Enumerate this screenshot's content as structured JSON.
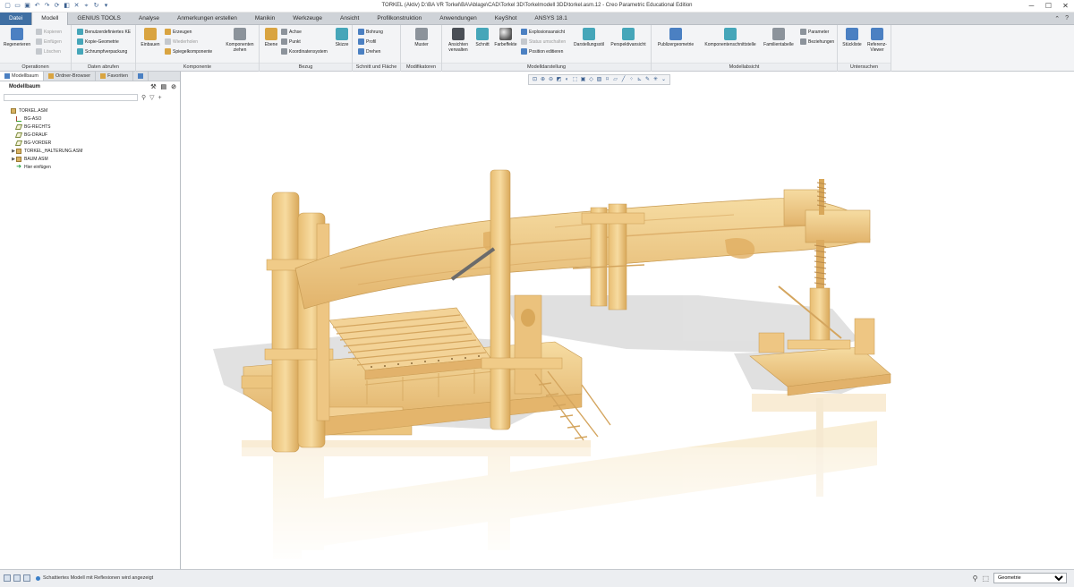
{
  "window": {
    "title": "TORKEL (Aktiv) D:\\BA VR Torkel\\BA\\Ablage\\CAD\\Torkel 3D\\Torkelmodell 3DD\\torkel.asm.12 - Creo Parametric Educational Edition"
  },
  "tabs": [
    {
      "label": "Datei"
    },
    {
      "label": "Modell"
    },
    {
      "label": "GENIUS TOOLS"
    },
    {
      "label": "Analyse"
    },
    {
      "label": "Anmerkungen erstellen"
    },
    {
      "label": "Manikin"
    },
    {
      "label": "Werkzeuge"
    },
    {
      "label": "Ansicht"
    },
    {
      "label": "Profilkonstruktion"
    },
    {
      "label": "Anwendungen"
    },
    {
      "label": "KeyShot"
    },
    {
      "label": "ANSYS 18.1"
    }
  ],
  "ribbon": {
    "operationen": {
      "label": "Operationen",
      "regenerieren": "Regenerieren",
      "kopieren": "Kopieren",
      "einfuegen": "Einfügen",
      "loeschen": "Löschen"
    },
    "daten": {
      "label": "Daten abrufen",
      "benutzer": "Benutzerdefiniertes KE",
      "kopie": "Kopie-Geometrie",
      "schrumpf": "Schrumpfverpackung"
    },
    "komponente": {
      "label": "Komponente",
      "einbauen": "Einbauen",
      "erzeugen": "Erzeugen",
      "wiederholen": "Wiederholen",
      "spiegel": "Spiegelkomponente",
      "ziehen": "Komponenten ziehen"
    },
    "bezug": {
      "label": "Bezug",
      "ebene": "Ebene",
      "achse": "Achse",
      "punkt": "Punkt",
      "koord": "Koordinatensystem",
      "skizze": "Skizze"
    },
    "schnitt": {
      "label": "Schnitt und Fläche",
      "bohrung": "Bohrung",
      "profil": "Profil",
      "drehen": "Drehen"
    },
    "modifikatoren": {
      "label": "Modifikatoren",
      "muster": "Muster"
    },
    "modelldarstellung": {
      "label": "Modelldarstellung",
      "ansichten": "Ansichten verwalten",
      "schnitt": "Schnitt",
      "farbe": "Farbeffekte",
      "explosion": "Explosionsansicht",
      "status": "Status umschalten",
      "position": "Position editieren",
      "darstellungsstil": "Darstellungsstil",
      "perspektiv": "Perspektivansicht"
    },
    "modellabsicht": {
      "label": "Modellabsicht",
      "publizier": "Publizergeometrie",
      "schnittstelle": "Komponentenschnittstelle",
      "familien": "Familientabelle",
      "parameter": "Parameter",
      "beziehungen": "Beziehungen"
    },
    "untersuchen": {
      "label": "Untersuchen",
      "stueckliste": "Stückliste",
      "referenz": "Referenz-Viewer"
    }
  },
  "sidebar": {
    "tabs": [
      {
        "label": "Modellbaum"
      },
      {
        "label": "Ordner-Browser"
      },
      {
        "label": "Favoriten"
      }
    ],
    "heading": "Modellbaum",
    "search_placeholder": "",
    "tree": [
      {
        "label": "TORKEL.ASM",
        "icon": "asm",
        "expander": ""
      },
      {
        "label": "BG-ASO",
        "icon": "csys",
        "expander": ""
      },
      {
        "label": "BG-RECHTS",
        "icon": "plane",
        "expander": ""
      },
      {
        "label": "BG-DRAUF",
        "icon": "plane",
        "expander": ""
      },
      {
        "label": "BG-VORDER",
        "icon": "plane",
        "expander": ""
      },
      {
        "label": "TORKEL_HALTERUNG.ASM",
        "icon": "asm",
        "expander": "▶"
      },
      {
        "label": "BAUM.ASM",
        "icon": "asm",
        "expander": "▶"
      },
      {
        "label": "Hier einfügen",
        "icon": "insert",
        "expander": ""
      }
    ]
  },
  "statusbar": {
    "message": "Schattiertes Modell mit Reflexionen wird angezeigt",
    "filter_value": "Geometrie"
  },
  "colors": {
    "wood": "#f2cf8a",
    "wood_dark": "#d9a85a",
    "accent": "#3f6fa3"
  }
}
